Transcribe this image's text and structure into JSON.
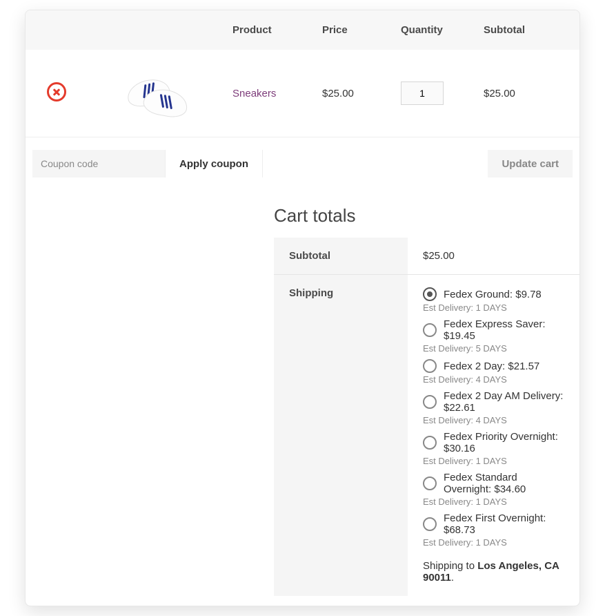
{
  "headers": {
    "product": "Product",
    "price": "Price",
    "quantity": "Quantity",
    "subtotal": "Subtotal"
  },
  "item": {
    "name": "Sneakers",
    "price": "$25.00",
    "qty": "1",
    "subtotal": "$25.00"
  },
  "coupon": {
    "placeholder": "Coupon code",
    "apply": "Apply coupon"
  },
  "update_cart": "Update cart",
  "cart_totals_title": "Cart totals",
  "totals": {
    "subtotal_label": "Subtotal",
    "subtotal_value": "$25.00",
    "shipping_label": "Shipping"
  },
  "shipping": {
    "options": [
      {
        "label": "Fedex Ground: ",
        "price": "$9.78",
        "est": "Est Delivery: 1 DAYS",
        "checked": true
      },
      {
        "label": "Fedex Express Saver: ",
        "price": "$19.45",
        "est": "Est Delivery: 5 DAYS",
        "checked": false
      },
      {
        "label": "Fedex 2 Day: ",
        "price": "$21.57",
        "est": "Est Delivery: 4 DAYS",
        "checked": false
      },
      {
        "label": "Fedex 2 Day AM Delivery: ",
        "price": "$22.61",
        "est": "Est Delivery: 4 DAYS",
        "checked": false
      },
      {
        "label": "Fedex Priority Overnight: ",
        "price": "$30.16",
        "est": "Est Delivery: 1 DAYS",
        "checked": false
      },
      {
        "label": "Fedex Standard Overnight: ",
        "price": "$34.60",
        "est": "Est Delivery: 1 DAYS",
        "checked": false
      },
      {
        "label": "Fedex First Overnight: ",
        "price": "$68.73",
        "est": "Est Delivery: 1 DAYS",
        "checked": false
      }
    ],
    "ship_to_prefix": "Shipping to ",
    "ship_to_location": "Los Angeles, CA 90011",
    "ship_to_suffix": "."
  }
}
